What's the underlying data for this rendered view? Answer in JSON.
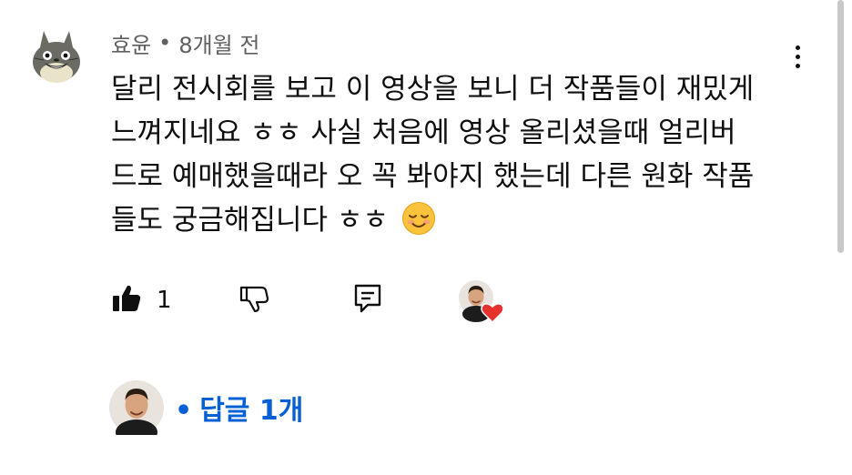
{
  "comment": {
    "author": "효윤",
    "separator": "•",
    "time": "8개월 전",
    "lines": [
      "달리 전시회를 보고 이 영상을 보니 더 작품들이 재밌게",
      "느껴지네요 ㅎㅎ 사실 처음에 영상 올리셨을때 얼리버",
      "드로 예매했을때라 오 꼭 봐야지 했는데 다른 원화 작품",
      "들도 궁금해집니다 ㅎㅎ"
    ],
    "emoji": "smiling-face-emoji"
  },
  "actions": {
    "like_icon": "thumbs-up-filled-icon",
    "like_count": "1",
    "dislike_icon": "thumbs-down-icon",
    "reply_icon": "comment-reply-icon",
    "creator_heart_icon": "heart-icon"
  },
  "replies": {
    "separator": "•",
    "label": "답글 1개"
  },
  "colors": {
    "link": "#065fd4",
    "meta": "#606060",
    "text": "#0f0f0f",
    "heart": "#e5322d"
  }
}
